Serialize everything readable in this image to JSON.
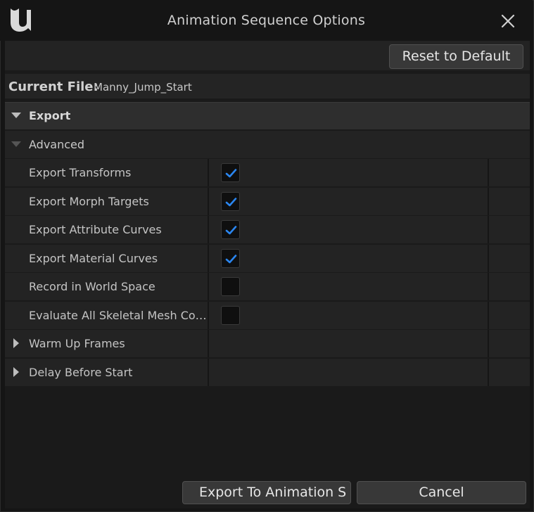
{
  "window": {
    "title": "Animation Sequence Options",
    "logo_icon": "unreal-engine-logo",
    "close_icon": "close-icon"
  },
  "toolbar": {
    "reset_label": "Reset to Default"
  },
  "current_file": {
    "label": "Current File:",
    "value": "Manny_Jump_Start"
  },
  "sections": {
    "export": {
      "label": "Export",
      "expanded": true
    },
    "advanced": {
      "label": "Advanced",
      "expanded": true
    }
  },
  "properties": [
    {
      "label": "Export Transforms",
      "type": "checkbox",
      "checked": true
    },
    {
      "label": "Export Morph Targets",
      "type": "checkbox",
      "checked": true
    },
    {
      "label": "Export Attribute Curves",
      "type": "checkbox",
      "checked": true
    },
    {
      "label": "Export Material Curves",
      "type": "checkbox",
      "checked": true
    },
    {
      "label": "Record in World Space",
      "type": "checkbox",
      "checked": false
    },
    {
      "label": "Evaluate All Skeletal Mesh Compo…",
      "type": "checkbox",
      "checked": false
    },
    {
      "label": "Warm Up Frames",
      "type": "expandable",
      "expanded": false
    },
    {
      "label": "Delay Before Start",
      "type": "expandable",
      "expanded": false
    }
  ],
  "footer": {
    "export_label": "Export To Animation S",
    "cancel_label": "Cancel"
  },
  "colors": {
    "background": "#151515",
    "panel": "#232323",
    "header": "#2e2e2e",
    "checkmark": "#2a86f0",
    "button": "#383838"
  }
}
